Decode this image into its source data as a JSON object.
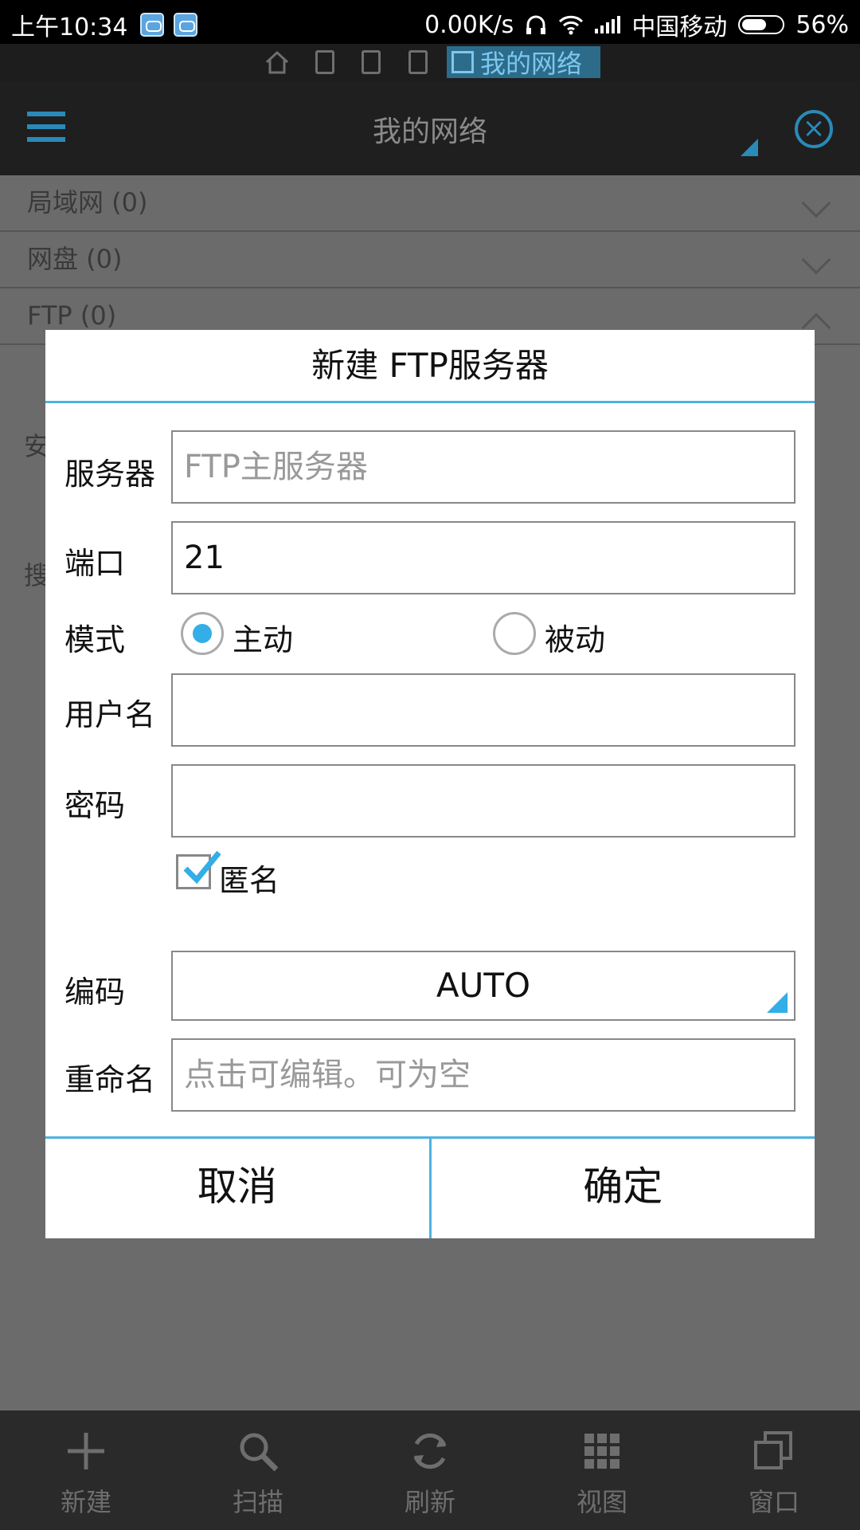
{
  "status_bar": {
    "time": "上午10:34",
    "net_speed": "0.00K/s",
    "carrier": "中国移动",
    "battery": "56%"
  },
  "window_tab": {
    "active_label": "我的网络"
  },
  "header": {
    "title": "我的网络"
  },
  "background_list": {
    "rows": [
      {
        "label": "局域网 (0)"
      },
      {
        "label": "网盘 (0)"
      },
      {
        "label": "FTP (0)"
      }
    ],
    "fragments": [
      "安",
      "搜"
    ]
  },
  "dialog": {
    "title": "新建 FTP服务器",
    "server": {
      "label": "服务器",
      "placeholder": "FTP主服务器",
      "value": ""
    },
    "port": {
      "label": "端口",
      "value": "21"
    },
    "mode": {
      "label": "模式",
      "options": [
        "主动",
        "被动"
      ],
      "selected": "主动"
    },
    "username": {
      "label": "用户名",
      "value": ""
    },
    "password": {
      "label": "密码",
      "value": ""
    },
    "anonymous": {
      "label": "匿名",
      "checked": true
    },
    "encoding": {
      "label": "编码",
      "value": "AUTO"
    },
    "rename": {
      "label": "重命名",
      "placeholder": "点击可编辑。可为空"
    },
    "cancel_label": "取消",
    "ok_label": "确定"
  },
  "toolbar": {
    "items": [
      {
        "label": "新建",
        "icon": "plus-icon"
      },
      {
        "label": "扫描",
        "icon": "search-icon"
      },
      {
        "label": "刷新",
        "icon": "refresh-icon"
      },
      {
        "label": "视图",
        "icon": "grid-icon"
      },
      {
        "label": "窗口",
        "icon": "windows-icon"
      }
    ]
  },
  "colors": {
    "accent": "#33aee6",
    "header_bg": "#1f1f1f",
    "overlay_bg": "#6b6b6b"
  }
}
